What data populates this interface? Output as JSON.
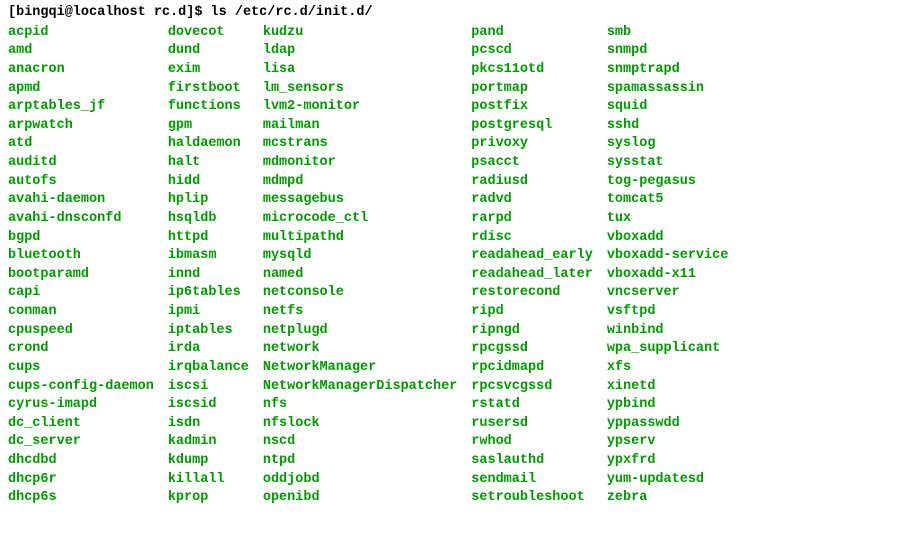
{
  "prompt": {
    "userhost": "[bingqi@localhost rc.d]$",
    "command": "ls /etc/rc.d/init.d/"
  },
  "columns": [
    [
      "acpid",
      "amd",
      "anacron",
      "apmd",
      "arptables_jf",
      "arpwatch",
      "atd",
      "auditd",
      "autofs",
      "avahi-daemon",
      "avahi-dnsconfd",
      "bgpd",
      "bluetooth",
      "bootparamd",
      "capi",
      "conman",
      "cpuspeed",
      "crond",
      "cups",
      "cups-config-daemon",
      "cyrus-imapd",
      "dc_client",
      "dc_server",
      "dhcdbd",
      "dhcp6r",
      "dhcp6s"
    ],
    [
      "dovecot",
      "dund",
      "exim",
      "firstboot",
      "functions",
      "gpm",
      "haldaemon",
      "halt",
      "hidd",
      "hplip",
      "hsqldb",
      "httpd",
      "ibmasm",
      "innd",
      "ip6tables",
      "ipmi",
      "iptables",
      "irda",
      "irqbalance",
      "iscsi",
      "iscsid",
      "isdn",
      "kadmin",
      "kdump",
      "killall",
      "kprop"
    ],
    [
      "kudzu",
      "ldap",
      "lisa",
      "lm_sensors",
      "lvm2-monitor",
      "mailman",
      "mcstrans",
      "mdmonitor",
      "mdmpd",
      "messagebus",
      "microcode_ctl",
      "multipathd",
      "mysqld",
      "named",
      "netconsole",
      "netfs",
      "netplugd",
      "network",
      "NetworkManager",
      "NetworkManagerDispatcher",
      "nfs",
      "nfslock",
      "nscd",
      "ntpd",
      "oddjobd",
      "openibd"
    ],
    [
      "pand",
      "pcscd",
      "pkcs11otd",
      "portmap",
      "postfix",
      "postgresql",
      "privoxy",
      "psacct",
      "radiusd",
      "radvd",
      "rarpd",
      "rdisc",
      "readahead_early",
      "readahead_later",
      "restorecond",
      "ripd",
      "ripngd",
      "rpcgssd",
      "rpcidmapd",
      "rpcsvcgssd",
      "rstatd",
      "rusersd",
      "rwhod",
      "saslauthd",
      "sendmail",
      "setroubleshoot"
    ],
    [
      "smb",
      "snmpd",
      "snmptrapd",
      "spamassassin",
      "squid",
      "sshd",
      "syslog",
      "sysstat",
      "tog-pegasus",
      "tomcat5",
      "tux",
      "vboxadd",
      "vboxadd-service",
      "vboxadd-x11",
      "vncserver",
      "vsftpd",
      "winbind",
      "wpa_supplicant",
      "xfs",
      "xinetd",
      "ypbind",
      "yppasswdd",
      "ypserv",
      "ypxfrd",
      "yum-updatesd",
      "zebra"
    ]
  ]
}
